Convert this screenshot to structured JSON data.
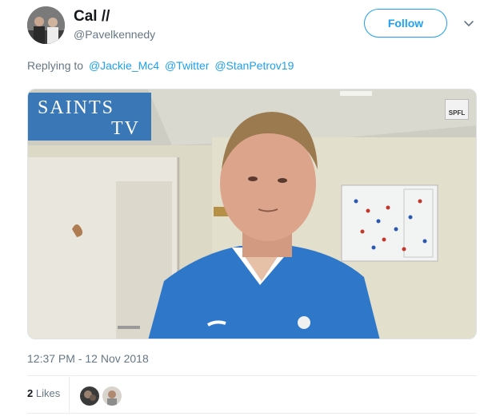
{
  "tweet": {
    "display_name": "Cal //",
    "handle": "@Pavelkennedy",
    "follow_label": "Follow",
    "reply_prefix": "Replying to",
    "reply_mentions": [
      "@Jackie_Mc4",
      "@Twitter",
      "@StanPetrov19"
    ],
    "timestamp": "12:37 PM - 12 Nov 2018"
  },
  "media": {
    "channel_line1": "SAINTS",
    "channel_line2": "TV",
    "league_badge": "SPFL"
  },
  "stats": {
    "likes_count": "2",
    "likes_label": "Likes"
  },
  "colors": {
    "accent": "#1da1f2",
    "secondary_text": "#657786",
    "saints_blue": "#3a77b6"
  }
}
